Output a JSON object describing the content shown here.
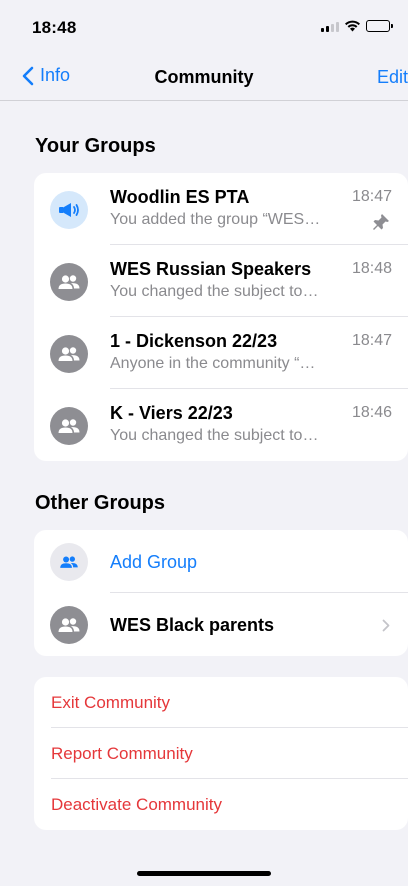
{
  "status_bar": {
    "time": "18:48"
  },
  "nav": {
    "back_label": "Info",
    "title": "Community",
    "edit_label": "Edit"
  },
  "your_groups": {
    "header": "Your Groups",
    "items": [
      {
        "name": "Woodlin ES PTA",
        "time": "18:47",
        "subtitle": "You added the group “WES…",
        "icon": "megaphone-icon",
        "pinned": true
      },
      {
        "name": "WES Russian Speakers",
        "time": "18:48",
        "subtitle": "You changed the subject to…",
        "icon": "group-icon"
      },
      {
        "name": "1 - Dickenson 22/23",
        "time": "18:47",
        "subtitle": "Anyone in the community “…",
        "icon": "group-icon"
      },
      {
        "name": "K - Viers 22/23",
        "time": "18:46",
        "subtitle": "You changed the subject to…",
        "icon": "group-icon"
      }
    ]
  },
  "other_groups": {
    "header": "Other Groups",
    "add_group_label": "Add Group",
    "items": [
      {
        "name": "WES Black parents",
        "icon": "group-icon"
      }
    ]
  },
  "actions": {
    "exit": "Exit Community",
    "report": "Report Community",
    "deactivate": "Deactivate Community"
  },
  "colors": {
    "accent": "#147efb",
    "destructive": "#e5373a",
    "background": "#f2f2f7"
  }
}
